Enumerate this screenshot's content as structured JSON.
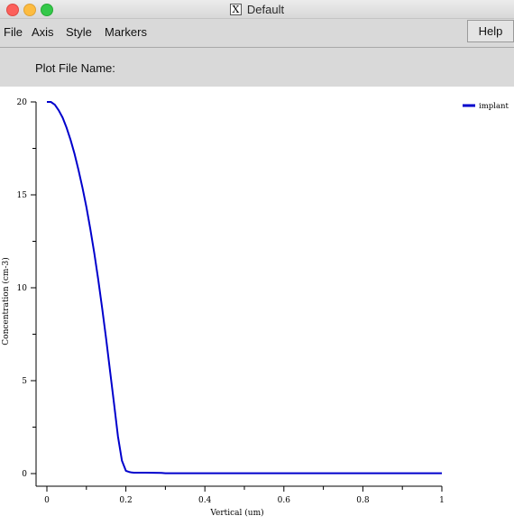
{
  "window": {
    "title": "Default",
    "title_icon": "x11-icon",
    "title_icon_glyph": "X"
  },
  "menu": {
    "items": [
      "File",
      "Axis",
      "Style",
      "Markers"
    ],
    "help_label": "Help"
  },
  "plot_file": {
    "label": "Plot File Name:",
    "value": ""
  },
  "colors": {
    "series": "#0000cc",
    "panel": "#d9d9d9",
    "axis": "#000000"
  },
  "chart_data": {
    "type": "line",
    "xlabel": "Vertical (um)",
    "ylabel": "Concentration (cm-3)",
    "xlim": [
      0,
      1
    ],
    "ylim": [
      0,
      20
    ],
    "x_ticks": [
      "0",
      "0.2",
      "0.4",
      "0.6",
      "0.8",
      "1"
    ],
    "y_ticks": [
      "0",
      "5",
      "10",
      "15",
      "20"
    ],
    "grid": false,
    "legend_position": "top-right",
    "series": [
      {
        "name": "implant",
        "x": [
          0,
          0.01,
          0.02,
          0.03,
          0.04,
          0.05,
          0.06,
          0.07,
          0.08,
          0.09,
          0.1,
          0.11,
          0.12,
          0.13,
          0.14,
          0.15,
          0.16,
          0.17,
          0.18,
          0.19,
          0.2,
          0.21,
          0.215,
          0.22,
          0.225,
          0.23,
          0.25,
          0.29,
          0.3,
          0.4,
          0.5,
          0.6,
          0.7,
          0.8,
          0.9,
          1.0
        ],
        "y": [
          20.0,
          20.0,
          19.85,
          19.55,
          19.15,
          18.6,
          17.95,
          17.2,
          16.35,
          15.4,
          14.35,
          13.15,
          11.85,
          10.45,
          8.9,
          7.25,
          5.5,
          3.75,
          2.0,
          0.7,
          0.15,
          0.08,
          0.06,
          0.05,
          0.05,
          0.05,
          0.05,
          0.04,
          0.02,
          0.02,
          0.02,
          0.02,
          0.02,
          0.02,
          0.02,
          0.02
        ]
      }
    ]
  }
}
